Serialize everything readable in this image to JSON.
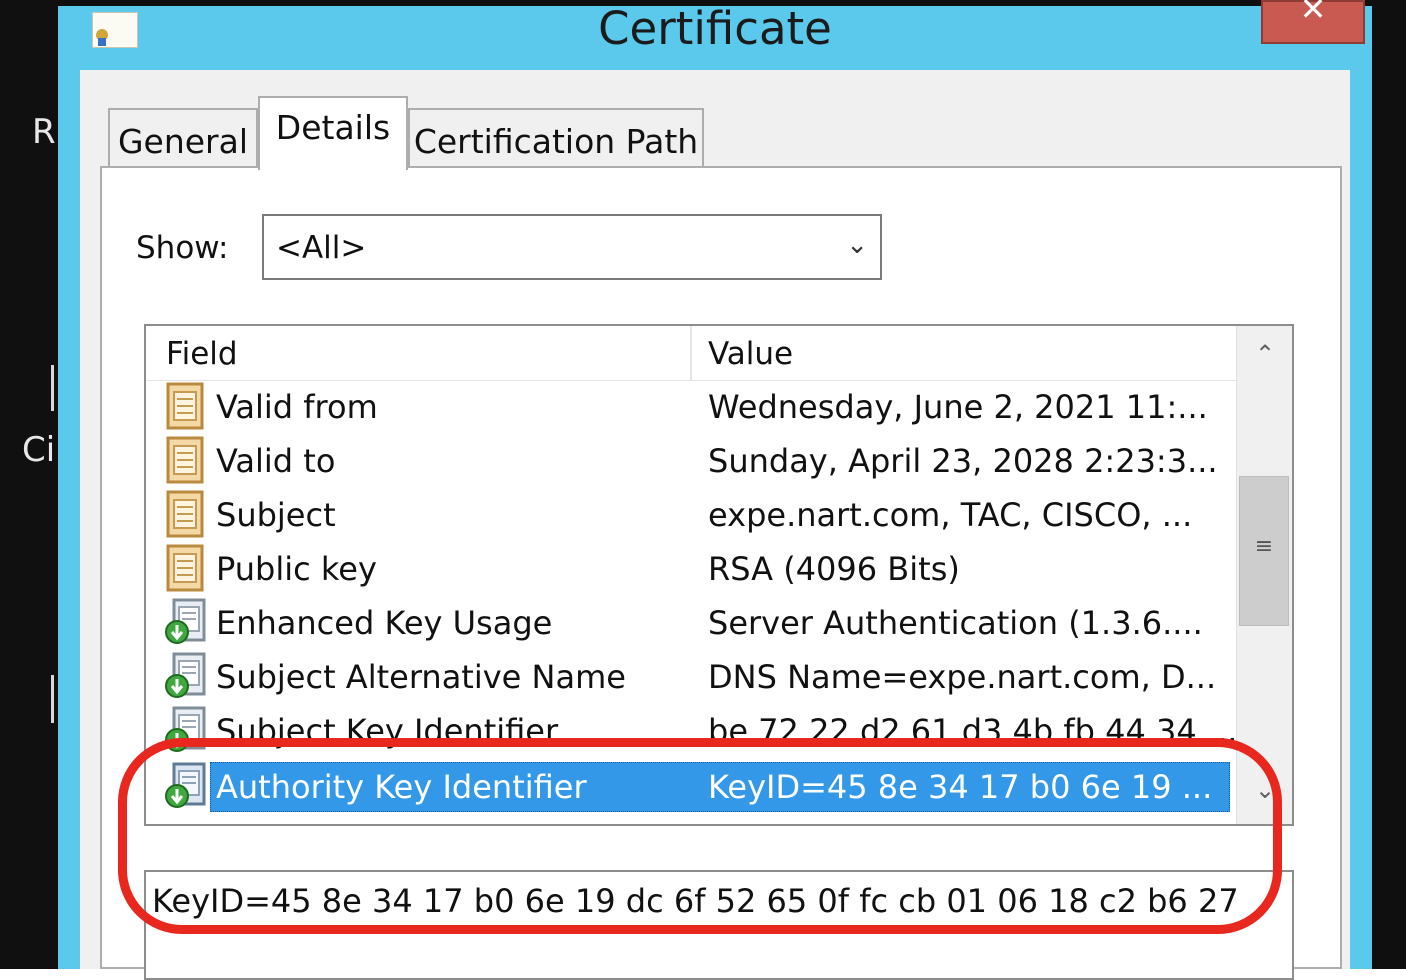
{
  "background": {
    "letters": [
      "R",
      "Ci"
    ]
  },
  "window": {
    "title": "Certificate",
    "close_glyph": "✕",
    "icon": "certificate-icon"
  },
  "tabs": [
    {
      "label": "General",
      "active": false
    },
    {
      "label": "Details",
      "active": true
    },
    {
      "label": "Certification Path",
      "active": false
    }
  ],
  "show": {
    "label": "Show:",
    "value": "<All>"
  },
  "list": {
    "columns": [
      "Field",
      "Value"
    ],
    "rows": [
      {
        "field": "Valid from",
        "value": "Wednesday, June 2, 2021 11:...",
        "icon": "property-icon"
      },
      {
        "field": "Valid to",
        "value": "Sunday, April 23, 2028 2:23:3...",
        "icon": "property-icon"
      },
      {
        "field": "Subject",
        "value": "expe.nart.com, TAC, CISCO, ...",
        "icon": "property-icon"
      },
      {
        "field": "Public key",
        "value": "RSA (4096 Bits)",
        "icon": "property-icon"
      },
      {
        "field": "Enhanced Key Usage",
        "value": "Server Authentication (1.3.6....",
        "icon": "extension-icon"
      },
      {
        "field": "Subject Alternative Name",
        "value": "DNS Name=expe.nart.com, D...",
        "icon": "extension-icon"
      },
      {
        "field": "Subject Key Identifier",
        "value": "be 72 22 d2 61 d3 4b fb 44 34 ...",
        "icon": "extension-icon"
      },
      {
        "field": "Authority Key Identifier",
        "value": "KeyID=45 8e 34 17 b0 6e 19 ...",
        "icon": "extension-icon",
        "selected": true
      }
    ]
  },
  "detail": {
    "text": "KeyID=45 8e 34 17 b0 6e 19 dc 6f 52 65 0f fc cb 01 06 18 c2 b6 27"
  },
  "annotation": {
    "color": "#e8281e"
  },
  "colors": {
    "titlebar": "#5ac9ec",
    "selection": "#3398e8",
    "close": "#c85a52"
  }
}
